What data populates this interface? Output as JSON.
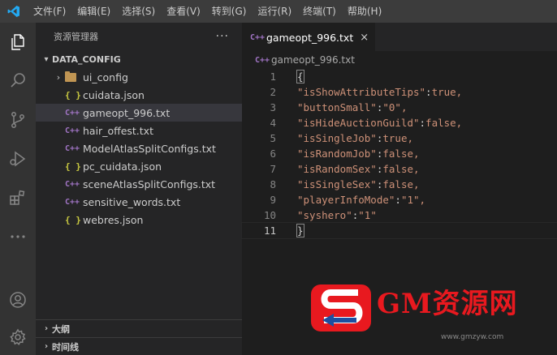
{
  "menu": [
    "文件(F)",
    "编辑(E)",
    "选择(S)",
    "查看(V)",
    "转到(G)",
    "运行(R)",
    "终端(T)",
    "帮助(H)"
  ],
  "sidebar": {
    "title": "资源管理器",
    "more": "···",
    "section": "DATA_CONFIG",
    "items": [
      {
        "name": "ui_config",
        "type": "folder"
      },
      {
        "name": "cuidata.json",
        "type": "json"
      },
      {
        "name": "gameopt_996.txt",
        "type": "txt",
        "selected": true
      },
      {
        "name": "hair_offest.txt",
        "type": "txt"
      },
      {
        "name": "ModelAtlasSplitConfigs.txt",
        "type": "txt"
      },
      {
        "name": "pc_cuidata.json",
        "type": "json"
      },
      {
        "name": "sceneAtlasSplitConfigs.txt",
        "type": "txt"
      },
      {
        "name": "sensitive_words.txt",
        "type": "txt"
      },
      {
        "name": "webres.json",
        "type": "json"
      }
    ],
    "outline": "大纲",
    "timeline": "时间线"
  },
  "icons": {
    "json_glyph": "{ }",
    "txt_glyph": "C++"
  },
  "editor": {
    "tab": "gameopt_996.txt",
    "close": "×",
    "breadcrumb": "gameopt_996.txt",
    "lines": [
      {
        "n": "1",
        "text": "{"
      },
      {
        "n": "2",
        "key": "\"isShowAttributeTips\"",
        "val": "true,"
      },
      {
        "n": "3",
        "key": "\"buttonSmall\"",
        "val": "\"0\","
      },
      {
        "n": "4",
        "key": "\"isHideAuctionGuild\"",
        "val": "false,"
      },
      {
        "n": "5",
        "key": "\"isSingleJob\"",
        "val": "true,"
      },
      {
        "n": "6",
        "key": "\"isRandomJob\"",
        "val": "false,"
      },
      {
        "n": "7",
        "key": "\"isRandomSex\"",
        "val": "false,"
      },
      {
        "n": "8",
        "key": "\"isSingleSex\"",
        "val": "false,"
      },
      {
        "n": "9",
        "key": "\"playerInfoMode\"",
        "val": "\"1\","
      },
      {
        "n": "10",
        "key": "\"syshero\"",
        "val": "\"1\""
      },
      {
        "n": "11",
        "text": "}"
      }
    ]
  },
  "watermark": {
    "brand": "GM资源网",
    "url": "www.gmzyw.com"
  },
  "colors": {
    "titlebar": "#3c3c3c",
    "activitybar": "#333333",
    "sidebar": "#252526",
    "editor": "#1e1e1e",
    "selected": "#37373d",
    "string": "#ce9178",
    "json_icon": "#cbcb41",
    "txt_icon": "#a074c4",
    "watermark": "#e8191f"
  }
}
